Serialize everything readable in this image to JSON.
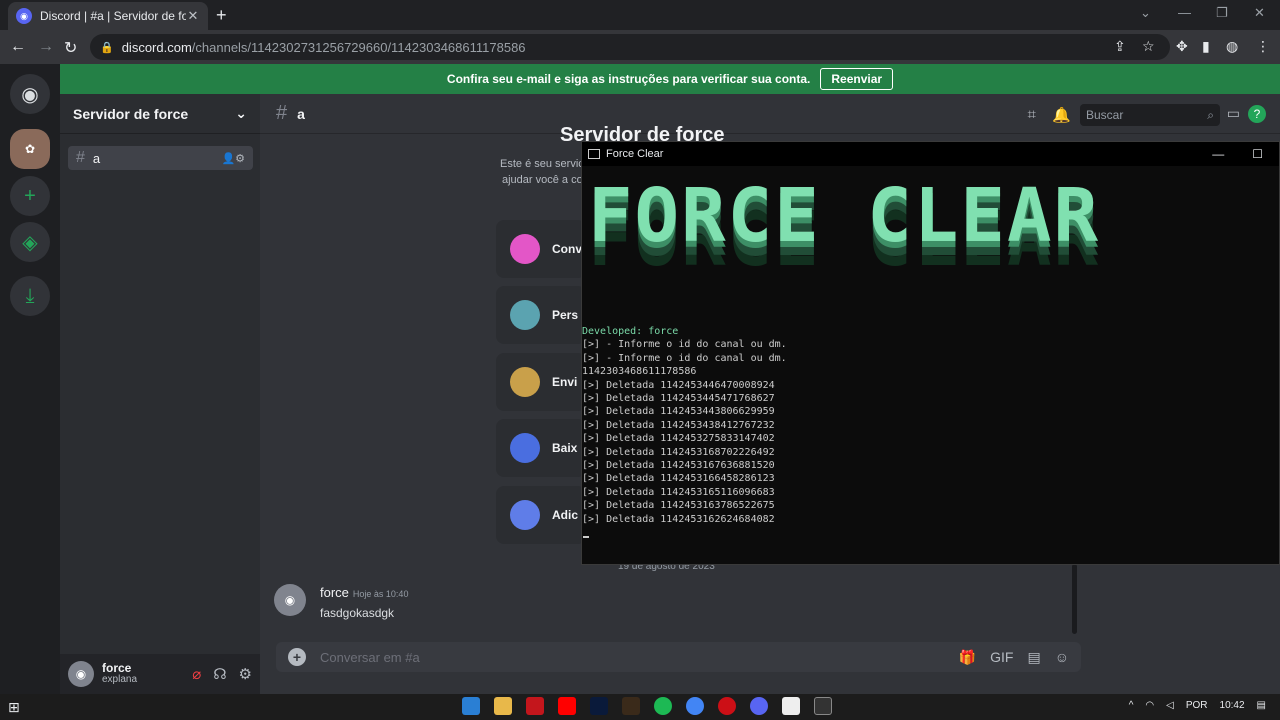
{
  "browser": {
    "tab_title": "Discord | #a | Servidor de force",
    "url_host": "discord.com",
    "url_path": "/channels/1142302731256729660/1142303468611178586"
  },
  "banner": {
    "text": "Confira seu e-mail e siga as instruções para verificar sua conta.",
    "button": "Reenviar"
  },
  "server": {
    "name": "Servidor de force",
    "channel": "a"
  },
  "header": {
    "channel": "a",
    "search_placeholder": "Buscar"
  },
  "welcome": {
    "title": "Servidor de force",
    "line1": "Este é seu servic",
    "line2": "ajudar você a co",
    "cards": [
      "Conv",
      "Pers",
      "Envi",
      "Baix",
      "Adic"
    ]
  },
  "chat": {
    "date_divider": "19 de agosto de 2023",
    "author": "force",
    "time": "Hoje às 10:40",
    "text": "fasdgokasdgk",
    "composer_placeholder": "Conversar em #a"
  },
  "user": {
    "name": "force",
    "status": "explana"
  },
  "terminal": {
    "title": "Force Clear",
    "art": "FORCE CLEAR",
    "developed": "Developed: force",
    "lines": [
      "[>] - Informe o id do canal ou dm.",
      "[>] - Informe o id do canal ou dm.",
      "1142303468611178586",
      "[>] Deletada 1142453446470008924",
      "[>] Deletada 1142453445471768627",
      "[>] Deletada 1142453443806629959",
      "[>] Deletada 1142453438412767232",
      "[>] Deletada 1142453275833147402",
      "[>] Deletada 1142453168702226492",
      "[>] Deletada 1142453167636881520",
      "[>] Deletada 1142453166458286123",
      "[>] Deletada 1142453165116096683",
      "[>] Deletada 1142453163786522675",
      "[>] Deletada 1142453162624684082"
    ]
  },
  "taskbar": {
    "lang": "POR",
    "time": "10:42"
  },
  "colors": {
    "discord_blurple": "#5865f2",
    "green": "#23a559",
    "terminal_green": "#80e0b0"
  }
}
